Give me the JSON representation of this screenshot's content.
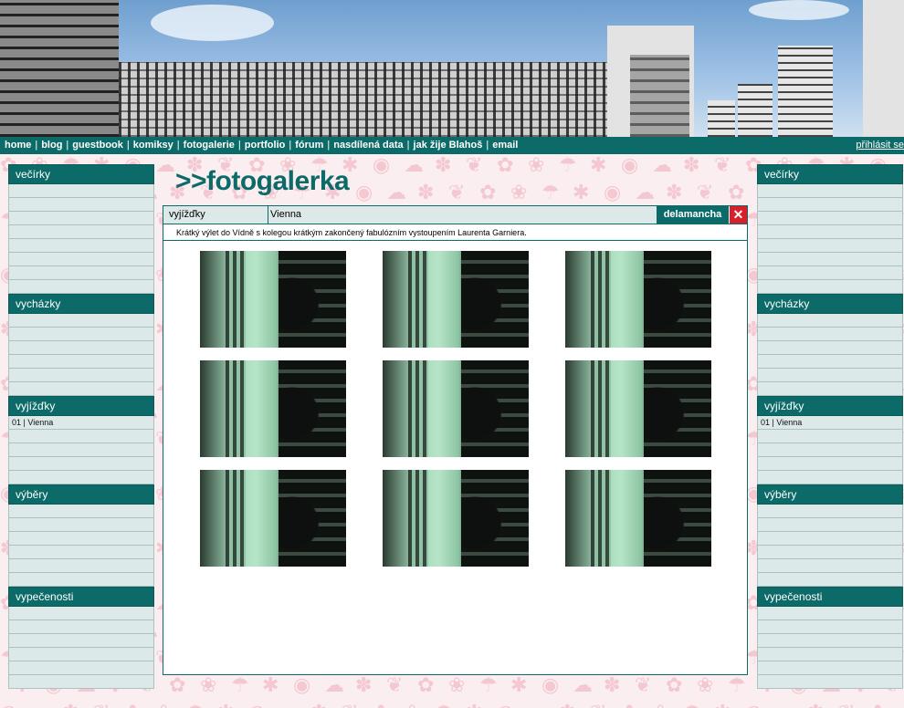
{
  "nav": {
    "items": [
      "home",
      "blog",
      "guestbook",
      "komiksy",
      "fotogalerie",
      "portfolio",
      "fórum",
      "nasdílená data",
      "jak žije Blahoš",
      "email"
    ],
    "login": "přihlásit se"
  },
  "sidebar": {
    "sections": [
      {
        "title": "večírky",
        "rows": [
          "",
          "",
          "",
          "",
          "",
          "",
          "",
          ""
        ]
      },
      {
        "title": "vycházky",
        "rows": [
          "",
          "",
          "",
          "",
          "",
          ""
        ]
      },
      {
        "title": "vyjížďky",
        "rows": [
          "01 | Vienna",
          "",
          "",
          "",
          ""
        ]
      },
      {
        "title": "výběry",
        "rows": [
          "",
          "",
          "",
          "",
          "",
          ""
        ]
      },
      {
        "title": "vypečenosti",
        "rows": [
          "",
          "",
          "",
          "",
          "",
          ""
        ]
      }
    ]
  },
  "main": {
    "logo": ">>fotogalerka",
    "category": "vyjížďky",
    "gallery_title": "Vienna",
    "tab_button": "delamancha",
    "close_symbol": "✕",
    "description": "Krátký výlet do Vídně s kolegou krátkým zakončený fabulózním vystoupením Laurenta Garniera.",
    "thumbnails": 9
  },
  "colors": {
    "accent": "#0c6b68",
    "close": "#d6202b",
    "row_bg": "#dde8e8",
    "page_bg": "#fbeef0"
  }
}
